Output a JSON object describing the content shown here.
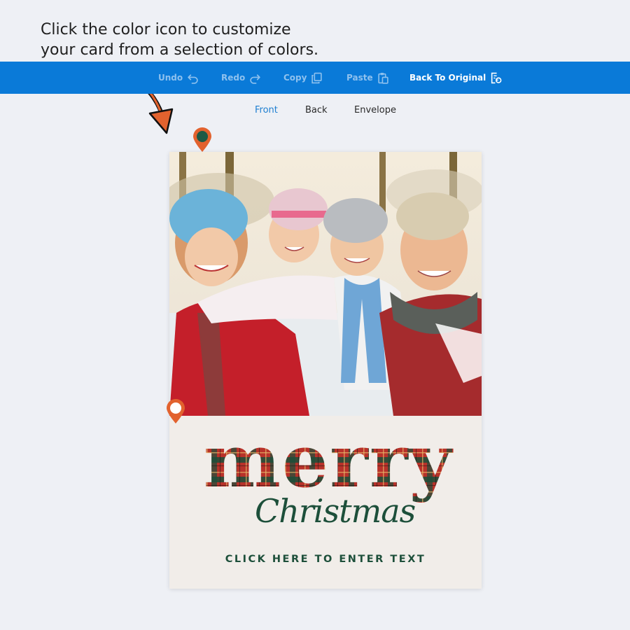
{
  "instruction": {
    "line1": "Click the color icon to customize",
    "line2": "your card from a selection of colors."
  },
  "toolbar": {
    "undo": {
      "label": "Undo",
      "icon": "undo-icon"
    },
    "redo": {
      "label": "Redo",
      "icon": "redo-icon"
    },
    "copy": {
      "label": "Copy",
      "icon": "copy-icon"
    },
    "paste": {
      "label": "Paste",
      "icon": "paste-icon"
    },
    "back_to_original": {
      "label": "Back To Original",
      "icon": "restore-icon"
    }
  },
  "tabs": [
    {
      "label": "Front",
      "active": true
    },
    {
      "label": "Back",
      "active": false
    },
    {
      "label": "Envelope",
      "active": false
    }
  ],
  "card": {
    "headline": "merry",
    "script": "Christmas",
    "cta": "CLICK HERE TO ENTER TEXT"
  },
  "color_pins": [
    {
      "name": "photo-color-pin",
      "color": "#1d5a45"
    },
    {
      "name": "background-color-pin",
      "color": "#ffffff"
    }
  ],
  "colors": {
    "toolbar_blue": "#0a7ad8",
    "pin_orange": "#e2622e",
    "text_green": "#1d4f3a",
    "plaid_red": "#b8322a"
  }
}
